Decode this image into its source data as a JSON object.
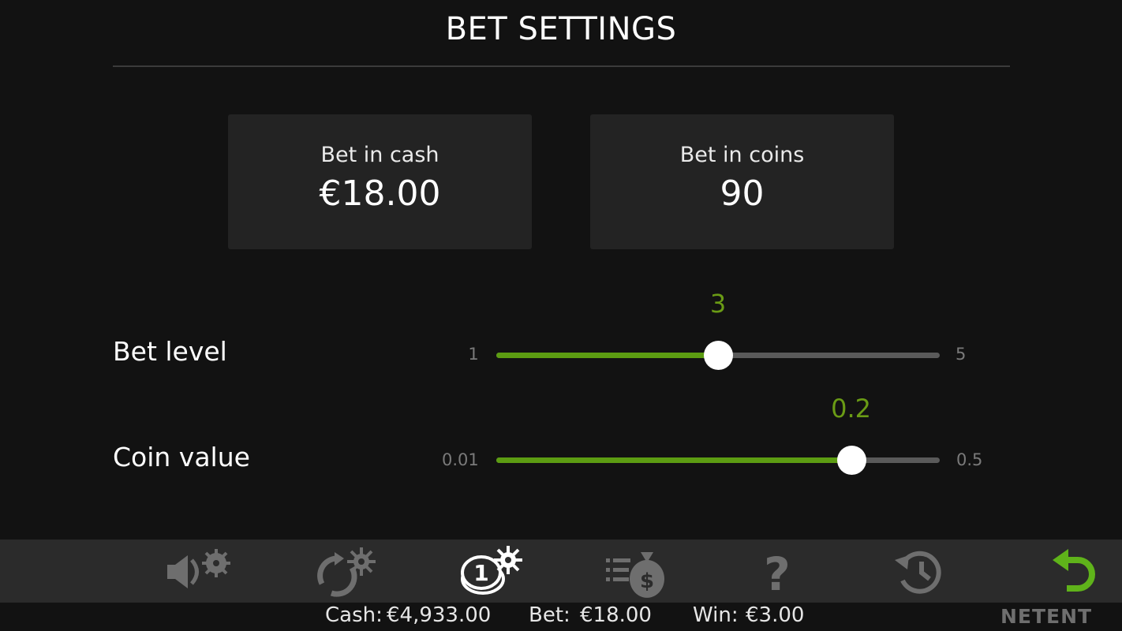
{
  "header": {
    "title": "BET SETTINGS"
  },
  "cards": {
    "cash": {
      "label": "Bet in cash",
      "value": "€18.00"
    },
    "coins": {
      "label": "Bet in coins",
      "value": "90"
    }
  },
  "bet_level": {
    "label": "Bet level",
    "min": "1",
    "max": "5",
    "current": "3",
    "fraction": 0.5
  },
  "coin_value": {
    "label": "Coin value",
    "min": "0.01",
    "max": "0.5",
    "current": "0.2",
    "fraction": 0.8
  },
  "toolbar": {
    "icons": [
      "sound-settings-icon",
      "autoplay-settings-icon",
      "bet-settings-icon",
      "paytable-icon",
      "help-icon",
      "history-icon",
      "back-icon"
    ],
    "active": "bet-settings-icon",
    "colors": {
      "inactive": "#6e6e6e",
      "active": "#ffffff",
      "back": "#5fb31a"
    }
  },
  "status_bar": {
    "cash_label": "Cash:",
    "cash_value": "€4,933.00",
    "bet_label": "Bet:",
    "bet_value": "€18.00",
    "win_label": "Win:",
    "win_value": "€3.00",
    "logo": "NETENT"
  }
}
